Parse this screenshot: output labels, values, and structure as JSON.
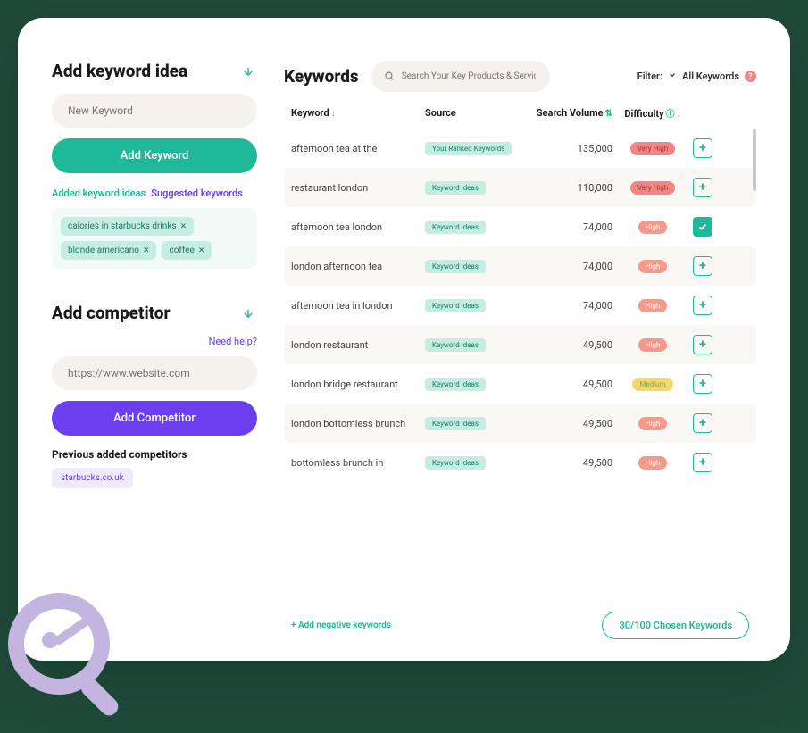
{
  "left": {
    "keyword_idea_title": "Add keyword idea",
    "new_keyword_placeholder": "New Keyword",
    "add_keyword_btn": "Add Keyword",
    "tab_added": "Added keyword ideas",
    "tab_suggested": "Suggested keywords",
    "chips": [
      "calories in starbucks drinks",
      "blonde americano",
      "coffee"
    ],
    "competitor_title": "Add competitor",
    "need_help": "Need help?",
    "competitor_placeholder": "https://www.website.com",
    "add_competitor_btn": "Add Competitor",
    "prev_added_label": "Previous added competitors",
    "prev_competitor": "starbucks.co.uk"
  },
  "right": {
    "title": "Keywords",
    "search_placeholder": "Search Your Key Products & Service",
    "filter_label": "Filter:",
    "filter_value": "All Keywords",
    "columns": {
      "keyword": "Keyword",
      "source": "Source",
      "volume": "Search Volume",
      "difficulty": "Difficulty"
    },
    "rows": [
      {
        "kw": "afternoon tea at the",
        "src": "Your Ranked Keywords",
        "src_class": "src-ranked",
        "vol": "135,000",
        "diff": "Very High",
        "diff_class": "diff-vhigh",
        "checked": false
      },
      {
        "kw": "restaurant london",
        "src": "Keyword Ideas",
        "src_class": "src-idea",
        "vol": "110,000",
        "diff": "Very High",
        "diff_class": "diff-vhigh",
        "checked": false
      },
      {
        "kw": "afternoon tea london",
        "src": "Keyword Ideas",
        "src_class": "src-idea",
        "vol": "74,000",
        "diff": "High",
        "diff_class": "diff-high",
        "checked": true
      },
      {
        "kw": "london afternoon tea",
        "src": "Keyword Ideas",
        "src_class": "src-idea",
        "vol": "74,000",
        "diff": "High",
        "diff_class": "diff-high",
        "checked": false
      },
      {
        "kw": "afternoon tea in london",
        "src": "Keyword Ideas",
        "src_class": "src-idea",
        "vol": "74,000",
        "diff": "High",
        "diff_class": "diff-high",
        "checked": false
      },
      {
        "kw": "london restaurant",
        "src": "Keyword Ideas",
        "src_class": "src-idea",
        "vol": "49,500",
        "diff": "High",
        "diff_class": "diff-high",
        "checked": false
      },
      {
        "kw": "london bridge restaurant",
        "src": "Keyword Ideas",
        "src_class": "src-idea",
        "vol": "49,500",
        "diff": "Medium",
        "diff_class": "diff-med",
        "checked": false
      },
      {
        "kw": "london bottomless brunch",
        "src": "Keyword Ideas",
        "src_class": "src-idea",
        "vol": "49,500",
        "diff": "High",
        "diff_class": "diff-high",
        "checked": false
      },
      {
        "kw": "bottomless brunch in",
        "src": "Keyword Ideas",
        "src_class": "src-idea",
        "vol": "49,500",
        "diff": "High",
        "diff_class": "diff-high",
        "checked": false
      }
    ],
    "add_negative": "+ Add negative keywords",
    "chosen": "30/100 Chosen Keywords"
  }
}
